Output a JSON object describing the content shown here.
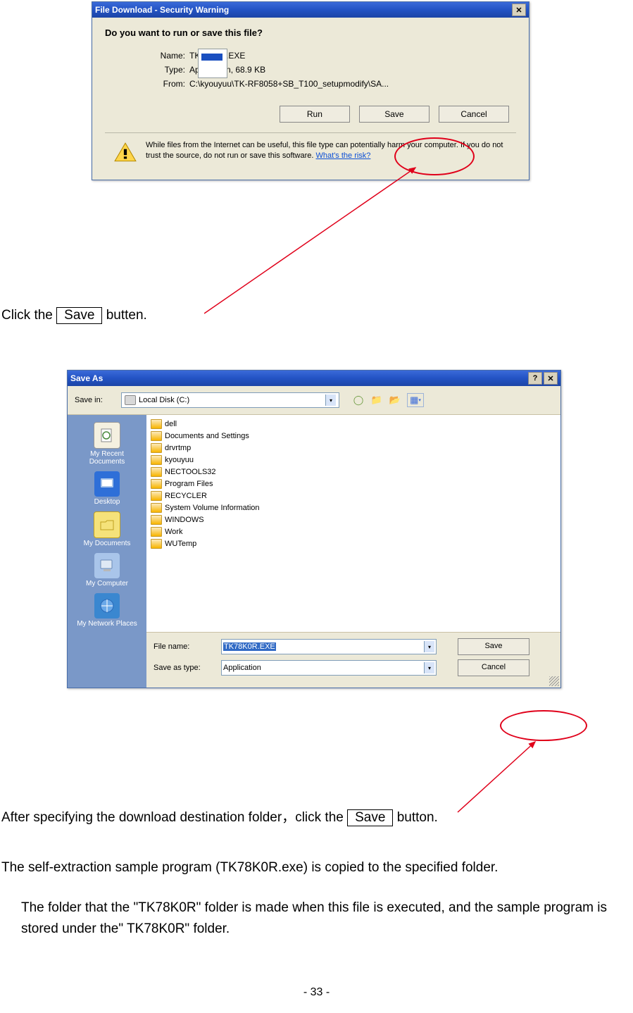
{
  "dialog1": {
    "title": "File Download - Security Warning",
    "question": "Do you want to run or save this file?",
    "name_label": "Name:",
    "name_value": "TK78K0R.EXE",
    "type_label": "Type:",
    "type_value": "Application, 68.9 KB",
    "from_label": "From:",
    "from_value": "C:\\kyouyuu\\TK-RF8058+SB_T100_setupmodify\\SA...",
    "run_btn": "Run",
    "save_btn": "Save",
    "cancel_btn": "Cancel",
    "warning_text": "While files from the Internet can be useful, this file type can potentially harm your computer. If you do not trust the source, do not run or save this software. ",
    "risk_link": "What's the risk?"
  },
  "instruction1_pre": "Click the ",
  "instruction1_btn": "Save",
  "instruction1_post": " butten.",
  "dialog2": {
    "title": "Save As",
    "savein_label": "Save in:",
    "savein_value": "Local Disk (C:)",
    "sidebar": [
      "My Recent Documents",
      "Desktop",
      "My Documents",
      "My Computer",
      "My Network Places"
    ],
    "files": [
      "dell",
      "Documents and Settings",
      "drvrtmp",
      "kyouyuu",
      "NECTOOLS32",
      "Program Files",
      "RECYCLER",
      "System Volume Information",
      "WINDOWS",
      "Work",
      "WUTemp"
    ],
    "filename_label": "File name:",
    "filename_value": "TK78K0R.EXE",
    "saveastype_label": "Save as type:",
    "saveastype_value": "Application",
    "save_btn": "Save",
    "cancel_btn": "Cancel"
  },
  "instruction2_pre": "After specifying the download destination folder，click the ",
  "instruction2_btn": "Save",
  "instruction2_post": " button.",
  "body_text1": "The self-extraction sample program (TK78K0R.exe) is copied to the specified folder.",
  "body_text2": "The folder that the \"TK78K0R\" folder is made when this file is executed, and the sample program is stored under the\" TK78K0R\" folder.",
  "page_number": "- 33 -"
}
